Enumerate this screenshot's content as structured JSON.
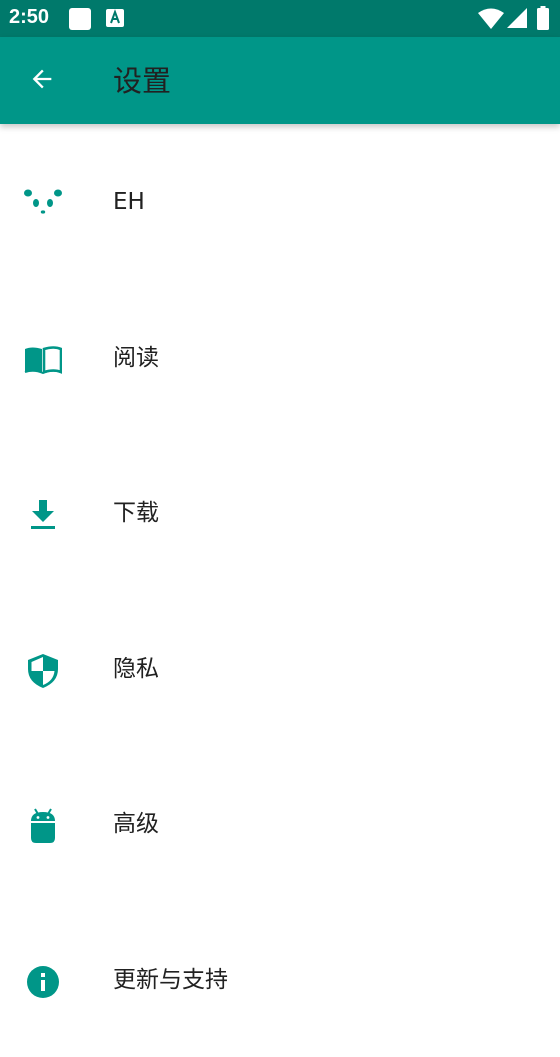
{
  "status_bar": {
    "time": "2:50",
    "icons": [
      "notification-square-icon",
      "a-letter-icon",
      "wifi-icon",
      "signal-icon",
      "battery-icon"
    ]
  },
  "toolbar": {
    "back_icon": "arrow-left-icon",
    "title": "设置"
  },
  "colors": {
    "status_bar": "#00796b",
    "app_bar": "#009688",
    "accent": "#009688",
    "text": "#212121",
    "background": "#ffffff"
  },
  "settings": {
    "items": [
      {
        "label": "EH",
        "icon": "panda-icon"
      },
      {
        "label": "阅读",
        "icon": "book-icon"
      },
      {
        "label": "下载",
        "icon": "download-icon"
      },
      {
        "label": "隐私",
        "icon": "shield-icon"
      },
      {
        "label": "高级",
        "icon": "android-icon"
      },
      {
        "label": "更新与支持",
        "icon": "info-icon"
      }
    ]
  }
}
